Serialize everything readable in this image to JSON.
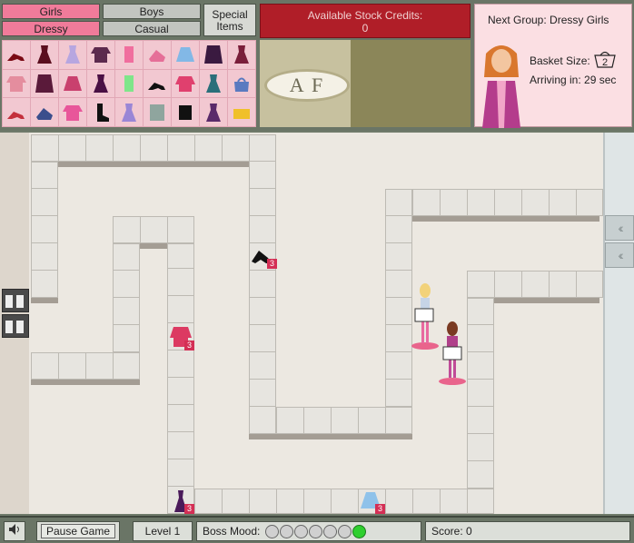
{
  "categories": {
    "girls": "Girls",
    "dressy": "Dressy",
    "boys": "Boys",
    "casual": "Casual",
    "special": "Special Items"
  },
  "credits": {
    "label": "Available Stock Credits:",
    "value": "0"
  },
  "logo": {
    "text": "A F"
  },
  "next_group": {
    "title": "Next Group: Dressy Girls",
    "basket_label": "Basket Size:",
    "basket_size": "2",
    "arriving": "Arriving in: 29 sec"
  },
  "floor_items": [
    {
      "name": "heels",
      "qty": "3"
    },
    {
      "name": "pink-sweater",
      "qty": "3"
    },
    {
      "name": "purple-dress",
      "qty": "3"
    },
    {
      "name": "blue-skirt",
      "qty": "3"
    }
  ],
  "bottom": {
    "pause": "Pause Game",
    "level": "Level 1",
    "mood_label": "Boss Mood:",
    "mood_level": 7,
    "score": "Score: 0"
  },
  "colors": {
    "pink": "#f07b9a",
    "credit_red": "#b01e28",
    "mood_green": "#2fcf2f",
    "shelf": "#e7e5e0"
  }
}
